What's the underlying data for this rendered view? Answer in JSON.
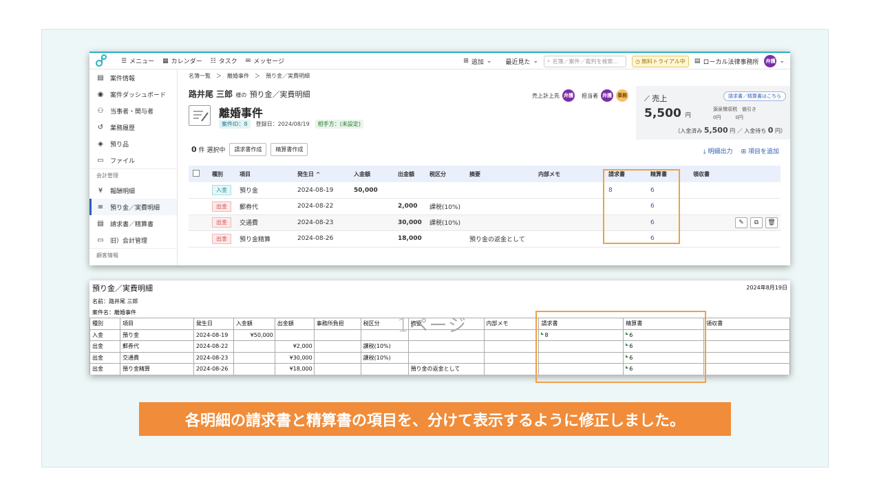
{
  "topbar": {
    "menu": "メニュー",
    "calendar": "カレンダー",
    "task": "タスク",
    "message": "メッセージ",
    "add": "追加",
    "recent": "最近見た",
    "search_placeholder": "名簿／案件／裁判を検索...",
    "trial": "無料トライアル中",
    "office": "ローカル法律事務所",
    "user_badge": "弁護"
  },
  "sidebar": {
    "items": [
      {
        "label": "案件情報"
      },
      {
        "label": "案件ダッシュボード"
      },
      {
        "label": "当事者・関与者"
      },
      {
        "label": "業務履歴"
      },
      {
        "label": "預り品"
      },
      {
        "label": "ファイル"
      }
    ],
    "section_accounting": "会計管理",
    "accounting_items": [
      {
        "label": "報酬明細"
      },
      {
        "label": "預り金／実費明細"
      },
      {
        "label": "請求書／精算書"
      },
      {
        "label": "旧）会計管理"
      }
    ],
    "section_client": "顧客情報"
  },
  "breadcrumb": "名簿一覧　＞　離婚事件　＞　預り金／実費明細",
  "header": {
    "person_name": "路井尾 三郎",
    "honorific": "様の",
    "page_title": "預り金／実費明細",
    "case_title": "離婚事件",
    "case_id": "案件ID：8",
    "registered": "登録日：2024/08/19",
    "opponent": "相手方：(未設定)",
    "sales_owner_label": "売上計上先",
    "assignee_label": "担当者",
    "badge_lawyer": "弁護",
    "badge_office": "事務"
  },
  "sales": {
    "title": "売上",
    "link": "請求書／精算書はこちら",
    "amount": "5,500",
    "unit": "円",
    "withholding_label": "源泉徴収税",
    "withholding_value": "0円",
    "discount_label": "値引き",
    "discount_value": "0円",
    "paid_label": "（入金済み",
    "paid_value": "5,500",
    "pending_label": "円 ／ 入金待ち",
    "pending_value": "0",
    "pending_unit": "円）"
  },
  "toolbar": {
    "selected_count": "0",
    "selected_label": "件 選択中",
    "create_invoice": "請求書作成",
    "create_statement": "精算書作成",
    "export": "明細出力",
    "add_item": "項目を追加"
  },
  "table": {
    "headers": [
      "種別",
      "項目",
      "発生日 ^",
      "入金額",
      "出金額",
      "税区分",
      "摘要",
      "内部メモ",
      "請求書",
      "精算書",
      "領収書"
    ],
    "rows": [
      {
        "type": "入金",
        "item": "預り金",
        "date": "2024-08-19",
        "in": "50,000",
        "out": "",
        "tax": "",
        "summary": "",
        "memo": "",
        "invoice": "8",
        "statement": "6"
      },
      {
        "type": "出金",
        "item": "郵券代",
        "date": "2024-08-22",
        "in": "",
        "out": "2,000",
        "tax": "課税(10%)",
        "summary": "",
        "memo": "",
        "invoice": "",
        "statement": "6"
      },
      {
        "type": "出金",
        "item": "交通費",
        "date": "2024-08-23",
        "in": "",
        "out": "30,000",
        "tax": "課税(10%)",
        "summary": "",
        "memo": "",
        "invoice": "",
        "statement": "6"
      },
      {
        "type": "出金",
        "item": "預り金精算",
        "date": "2024-08-26",
        "in": "",
        "out": "18,000",
        "tax": "",
        "summary": "預り金の返金として",
        "memo": "",
        "invoice": "",
        "statement": "6"
      }
    ]
  },
  "print": {
    "title": "預り金／実費明細",
    "date": "2024年8月19日",
    "name_line": "名前：路井尾 三郎",
    "case_line": "案件名：離婚事件",
    "watermark": "1ページ",
    "headers": [
      "種別",
      "項目",
      "発生日",
      "入金額",
      "出金額",
      "事務所負担",
      "税区分",
      "摘要",
      "内部メモ",
      "請求書",
      "精算書",
      "領収書"
    ],
    "rows": [
      {
        "type": "入金",
        "item": "預り金",
        "date": "2024-08-19",
        "in": "¥50,000",
        "out": "",
        "burden": "",
        "tax": "",
        "summary": "",
        "memo": "",
        "invoice": "8",
        "statement": "6",
        "receipt": ""
      },
      {
        "type": "出金",
        "item": "郵券代",
        "date": "2024-08-22",
        "in": "",
        "out": "¥2,000",
        "burden": "",
        "tax": "課税(10%)",
        "summary": "",
        "memo": "",
        "invoice": "",
        "statement": "6",
        "receipt": ""
      },
      {
        "type": "出金",
        "item": "交通費",
        "date": "2024-08-23",
        "in": "",
        "out": "¥30,000",
        "burden": "",
        "tax": "課税(10%)",
        "summary": "",
        "memo": "",
        "invoice": "",
        "statement": "6",
        "receipt": ""
      },
      {
        "type": "出金",
        "item": "預り金精算",
        "date": "2024-08-26",
        "in": "",
        "out": "¥18,000",
        "burden": "",
        "tax": "",
        "summary": "預り金の返金として",
        "memo": "",
        "invoice": "",
        "statement": "6",
        "receipt": ""
      }
    ]
  },
  "caption": "各明細の請求書と精算書の項目を、分けて表示するように修正しました。",
  "colors": {
    "accent": "#2bb3c0",
    "highlight": "#f0a046",
    "caption_bg": "#f08c3a",
    "link": "#2f5fb3"
  }
}
